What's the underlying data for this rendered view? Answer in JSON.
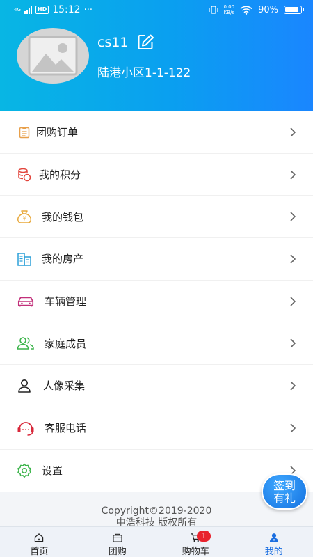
{
  "status_bar": {
    "network": "4G",
    "hd": "HD",
    "time": "15:12",
    "more": "···",
    "net_speed_value": "0.00",
    "net_speed_unit": "KB/s",
    "battery": "90%"
  },
  "profile": {
    "username": "cs11",
    "address": "陆港小区1-1-122"
  },
  "menu": [
    {
      "label": "团购订单",
      "icon": "clipboard-icon",
      "color": "#e8a04b"
    },
    {
      "label": "我的积分",
      "icon": "coins-icon",
      "color": "#e2443b"
    },
    {
      "label": "我的钱包",
      "icon": "money-bag-icon",
      "color": "#e8a83a"
    },
    {
      "label": "我的房产",
      "icon": "building-icon",
      "color": "#2a9fd8"
    },
    {
      "label": "车辆管理",
      "icon": "car-icon",
      "color": "#c2307a"
    },
    {
      "label": "家庭成员",
      "icon": "family-icon",
      "color": "#3bb44a"
    },
    {
      "label": "人像采集",
      "icon": "person-icon",
      "color": "#222222"
    },
    {
      "label": "客服电话",
      "icon": "headset-icon",
      "color": "#d8283a"
    },
    {
      "label": "设置",
      "icon": "gear-icon",
      "color": "#3bb44a"
    }
  ],
  "checkin": {
    "line1": "签到",
    "line2": "有礼"
  },
  "footer": {
    "copyright": "Copyright©2019-2020",
    "company": "中浩科技 版权所有"
  },
  "tabbar": {
    "tabs": [
      {
        "label": "首页",
        "icon": "home-icon"
      },
      {
        "label": "团购",
        "icon": "shop-icon"
      },
      {
        "label": "购物车",
        "icon": "cart-icon",
        "badge": "1"
      },
      {
        "label": "我的",
        "icon": "profile-icon",
        "active": true
      }
    ]
  },
  "colors": {
    "header_start": "#08b6e4",
    "header_end": "#1a86ff",
    "active_tab": "#1a6ee0",
    "badge": "#e8232e"
  }
}
